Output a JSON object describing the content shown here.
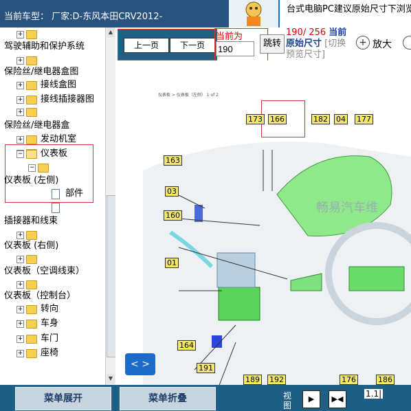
{
  "header": {
    "title": "当前车型： 厂家:D-东风本田CRV2012-"
  },
  "notice": {
    "text": "台式电脑PC建议原始尺寸下浏览"
  },
  "tree": {
    "items": [
      {
        "label": "",
        "type": "folder"
      },
      {
        "label": "驾驶辅助和保护系统",
        "type": "text"
      },
      {
        "label": "",
        "type": "folder"
      },
      {
        "label": "保险丝/继电器盒图",
        "type": "text"
      },
      {
        "label": "接线盒图",
        "type": "folder"
      },
      {
        "label": "接线插接器图",
        "type": "folder"
      },
      {
        "label": "",
        "type": "folder"
      },
      {
        "label": "保险丝/继电器盒",
        "type": "text"
      },
      {
        "label": "发动机室",
        "type": "folder"
      },
      {
        "label": "",
        "type": "folder"
      },
      {
        "label": "仪表板",
        "type": "folder-open"
      },
      {
        "label": "",
        "type": "folder"
      },
      {
        "label": "仪表板 (左侧)",
        "type": "text"
      },
      {
        "label": "部件",
        "type": "doc"
      },
      {
        "label": "",
        "type": "doc"
      },
      {
        "label": "插接器和线束",
        "type": "text"
      },
      {
        "label": "",
        "type": "folder"
      },
      {
        "label": "仪表板 (右侧)",
        "type": "text"
      },
      {
        "label": "",
        "type": "folder"
      },
      {
        "label": "仪表板（空调线束）",
        "type": "text"
      },
      {
        "label": "",
        "type": "folder"
      },
      {
        "label": "仪表板（控制台）",
        "type": "text"
      },
      {
        "label": "转向",
        "type": "folder"
      },
      {
        "label": "车身",
        "type": "folder"
      },
      {
        "label": "车门",
        "type": "folder"
      },
      {
        "label": "座椅",
        "type": "folder"
      }
    ]
  },
  "toolbar": {
    "prev_label": "上一页",
    "next_label": "下一页",
    "current_label": "当前为",
    "page_value": "190",
    "jump_label": "跳转",
    "page_count": "190/ 256",
    "current_text": "当前",
    "original_size": "原始尺寸",
    "switch_text": "[切换预览尺寸]",
    "zoom_in_label": "放大"
  },
  "diagram": {
    "header": "仪表板 > 仪表板（左侧） 1 of 2",
    "watermark": "畅易汽车维",
    "callouts": [
      "173",
      "166",
      "182",
      "04",
      "177",
      "163",
      "03",
      "160",
      "01",
      "164",
      "191",
      "189",
      "192",
      "176",
      "186"
    ]
  },
  "viewer": {
    "arrows_label": "< >"
  },
  "bottom": {
    "expand_label": "菜单展开",
    "collapse_label": "菜单折叠",
    "view_label": "视图",
    "ratio": "1.1|"
  },
  "colors": {
    "accent": "#1f5f86",
    "highlight": "#d33"
  }
}
